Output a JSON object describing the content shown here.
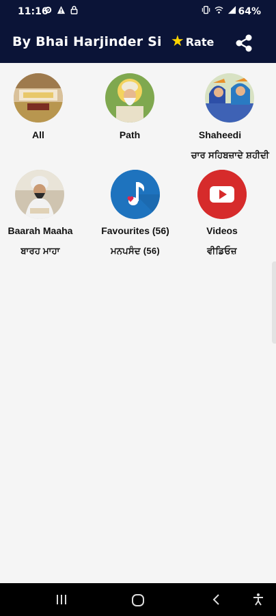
{
  "status_bar": {
    "time": "11:16",
    "battery": "64%",
    "left_icons": [
      "settings-icon",
      "warning-icon",
      "lock-icon"
    ],
    "right_icons": [
      "vibrate-icon",
      "wifi-icon",
      "signal-icon"
    ]
  },
  "app_bar": {
    "title": "By Bhai Harjinder Singh",
    "rate_label": "Rate",
    "rate_icon": "star-icon",
    "share_icon": "share-icon",
    "background": "#0b1437"
  },
  "tiles": [
    {
      "label": "All",
      "sub": ""
    },
    {
      "label": "Path",
      "sub": ""
    },
    {
      "label": "Shaheedi",
      "sub": "ਚਾਰ ਸਹਿਬਜ਼ਾਦੇ ਸ਼ਹੀਦੀ"
    },
    {
      "label": "Baarah Maaha",
      "sub": "ਬਾਰਹ ਮਾਹਾ"
    },
    {
      "label": "Favourites (56)",
      "sub": "ਮਨਪਸੰਦ (56)"
    },
    {
      "label": "Videos",
      "sub": "ਵੀਡਿਓਜ਼"
    }
  ],
  "nav_bar": {
    "buttons": [
      "recents-icon",
      "home-icon",
      "back-icon",
      "accessibility-icon"
    ]
  },
  "colors": {
    "favourites": "#1e73be",
    "videos": "#d62b2b"
  }
}
